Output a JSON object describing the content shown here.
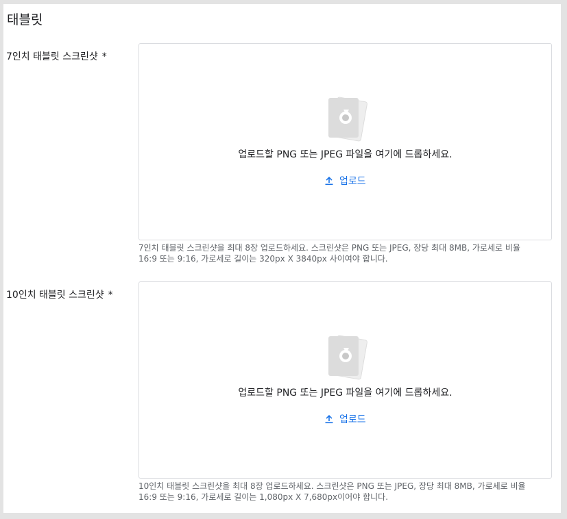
{
  "section": {
    "title": "태블릿"
  },
  "fields": [
    {
      "label": "7인치 태블릿 스크린샷",
      "required_mark": "*",
      "drop_text": "업로드할 PNG 또는 JPEG 파일을 여기에 드롭하세요.",
      "upload_label": "업로드",
      "helper_line1": "7인치 태블릿 스크린샷을 최대 8장 업로드하세요. 스크린샷은 PNG 또는 JPEG, 장당 최대 8MB, 가로세로 비율",
      "helper_line2": "16:9 또는 9:16, 가로세로 길이는 320px X 3840px 사이여야 합니다."
    },
    {
      "label": "10인치 태블릿 스크린샷",
      "required_mark": "*",
      "drop_text": "업로드할 PNG 또는 JPEG 파일을 여기에 드롭하세요.",
      "upload_label": "업로드",
      "helper_line1": "10인치 태블릿 스크린샷을 최대 8장 업로드하세요. 스크린샷은 PNG 또는 JPEG, 장당 최대 8MB, 가로세로 비율",
      "helper_line2": "16:9 또는 9:16, 가로세로 길이는 1,080px X 7,680px이어야 합니다."
    }
  ],
  "icons": {
    "image_placeholder": "image-placeholder-icon",
    "upload": "upload-icon"
  },
  "colors": {
    "accent": "#1a73e8",
    "text": "#202124",
    "helper": "#5f6368",
    "border": "#dadce0",
    "background": "#e3e3e3"
  }
}
